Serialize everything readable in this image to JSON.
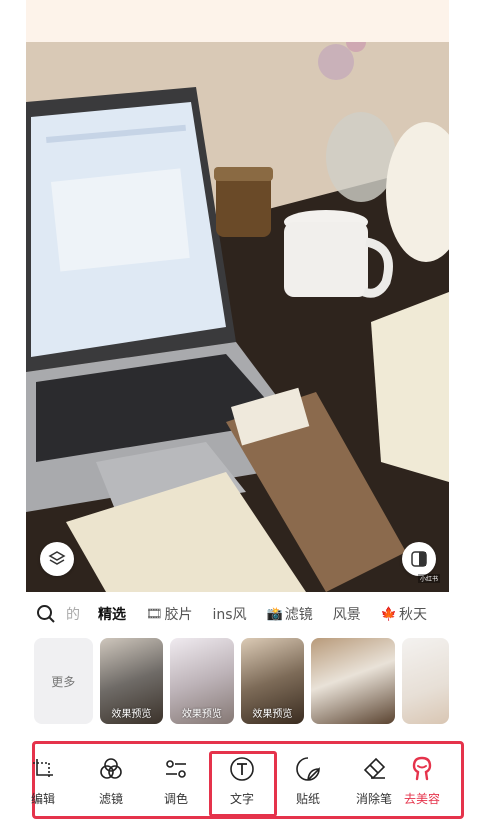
{
  "photo": {
    "watermark": "小红书",
    "layers_icon": "layers-icon",
    "compare_icon": "compare-icon"
  },
  "filter_tabs": [
    {
      "label": "的",
      "state": "faded"
    },
    {
      "label": "精选",
      "state": "active"
    },
    {
      "label": "胶片",
      "emoji": "🎞"
    },
    {
      "label": "ins风"
    },
    {
      "label": "滤镜",
      "emoji": "📸"
    },
    {
      "label": "风景"
    },
    {
      "label": "秋天",
      "emoji": "🍁"
    }
  ],
  "thumbnails": {
    "more_label": "更多",
    "items": [
      {
        "label": "效果预览"
      },
      {
        "label": "效果预览"
      },
      {
        "label": "效果预览"
      },
      {
        "label": ""
      },
      {
        "label": ""
      }
    ]
  },
  "toolbar": [
    {
      "label": "编辑",
      "icon": "crop-icon"
    },
    {
      "label": "滤镜",
      "icon": "filter-icon"
    },
    {
      "label": "调色",
      "icon": "adjust-icon"
    },
    {
      "label": "文字",
      "icon": "text-icon"
    },
    {
      "label": "贴纸",
      "icon": "sticker-icon"
    },
    {
      "label": "消除笔",
      "icon": "eraser-icon"
    },
    {
      "label": "去美容",
      "icon": "beauty-icon",
      "color": "#e5334b"
    }
  ],
  "colors": {
    "accent": "#e5334b"
  }
}
